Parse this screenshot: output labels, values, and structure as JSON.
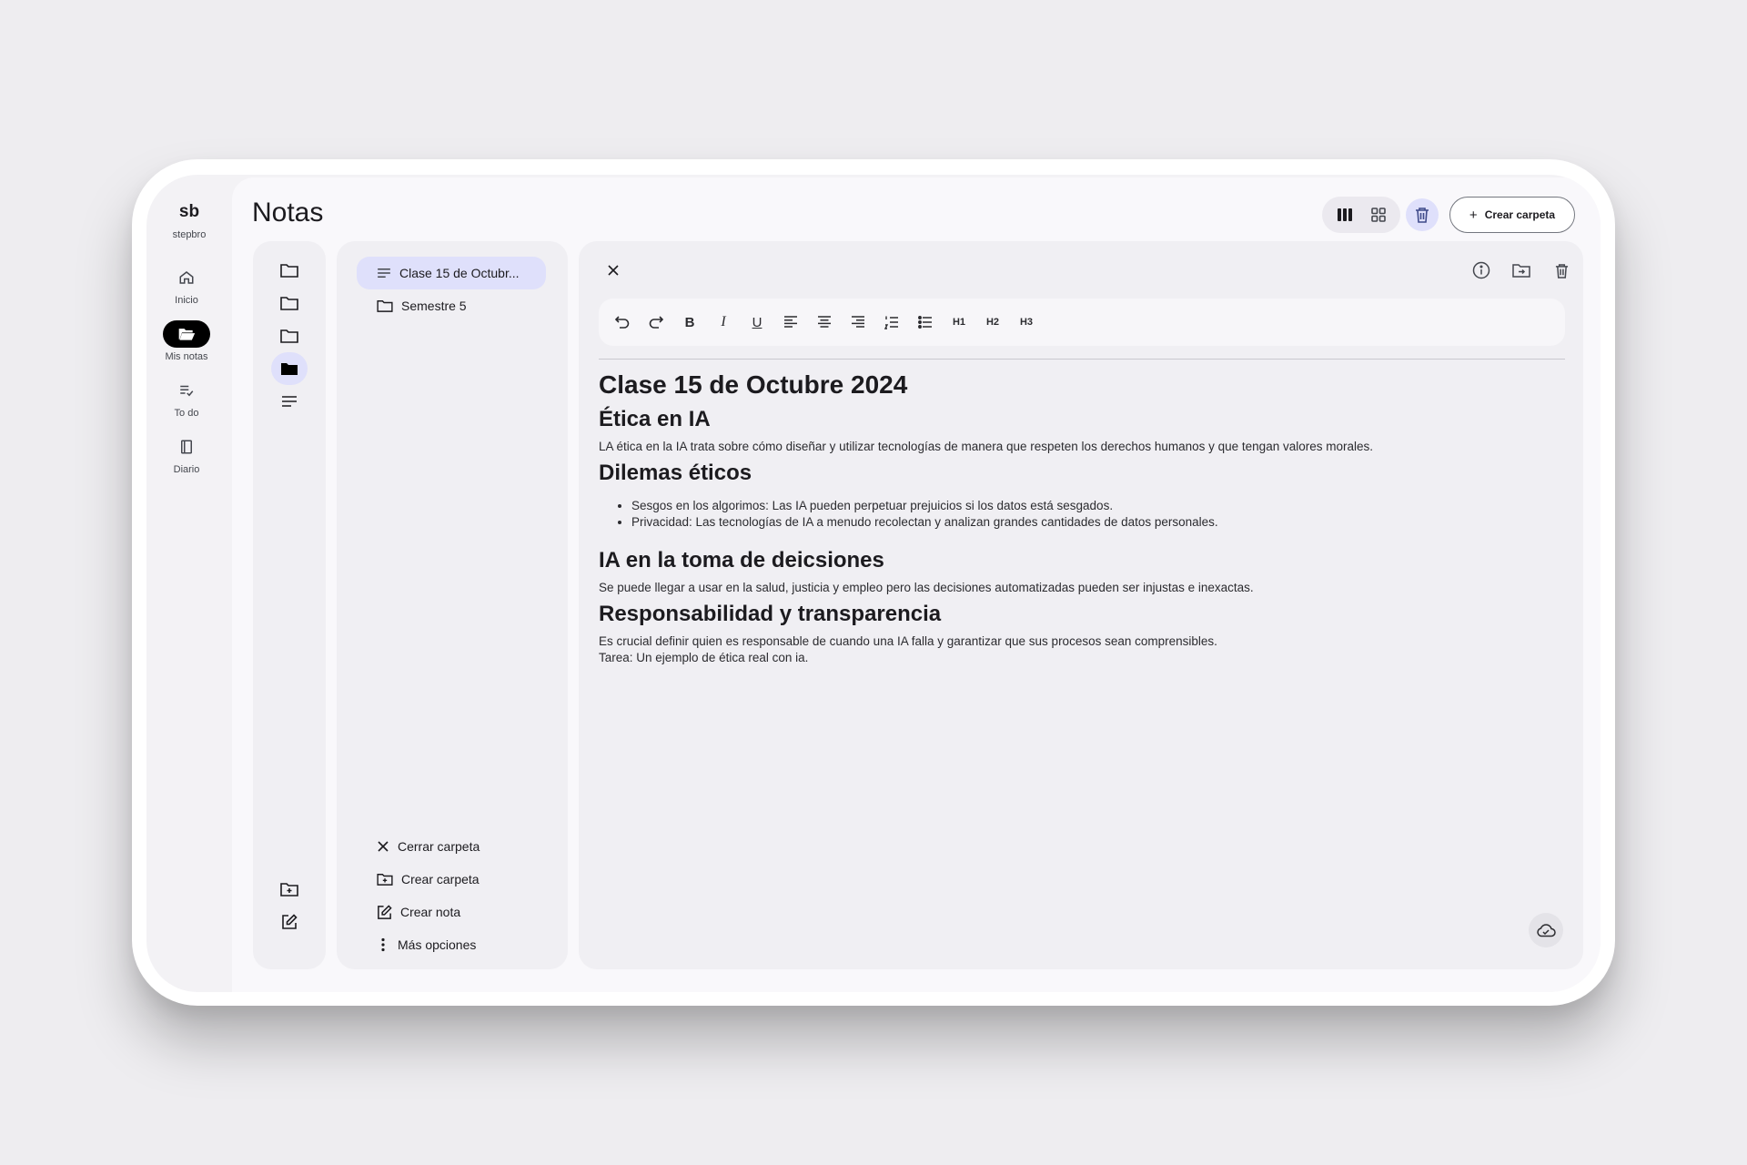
{
  "brand": {
    "logo": "sb",
    "username": "stepbro"
  },
  "nav": [
    {
      "label": "Inicio",
      "icon": "home-icon"
    },
    {
      "label": "Mis notas",
      "icon": "folder-open-icon",
      "active": true
    },
    {
      "label": "To do",
      "icon": "checklist-icon"
    },
    {
      "label": "Diario",
      "icon": "book-icon"
    }
  ],
  "header": {
    "title": "Notas",
    "create_folder_label": "Crear carpeta",
    "view_mode": "columns"
  },
  "folder_column": {
    "active_index": 3
  },
  "list": {
    "items": [
      {
        "label": "Clase 15 de Octubr...",
        "icon": "note-icon",
        "active": true
      },
      {
        "label": "Semestre 5",
        "icon": "folder-icon"
      }
    ],
    "actions": [
      {
        "label": "Cerrar carpeta",
        "icon": "close-icon"
      },
      {
        "label": "Crear carpeta",
        "icon": "folder-add-icon"
      },
      {
        "label": "Crear nota",
        "icon": "edit-note-icon"
      },
      {
        "label": "Más opciones",
        "icon": "more-vert-icon"
      }
    ]
  },
  "toolbar": {
    "h1": "H1",
    "h2": "H2",
    "h3": "H3"
  },
  "document": {
    "title": "Clase 15 de Octubre 2024",
    "s1_heading": "Ética en IA",
    "s1_text": "LA ética en la IA trata sobre cómo diseñar y utilizar tecnologías de manera que respeten los derechos humanos y que tengan valores morales.",
    "s2_heading": "Dilemas éticos",
    "s2_bullets": [
      "Sesgos en los algorimos: Las IA pueden perpetuar prejuicios si los datos está sesgados.",
      "Privacidad: Las tecnologías de IA a menudo recolectan y analizan grandes cantidades de datos personales."
    ],
    "s3_heading": "IA en la toma de deicsiones",
    "s3_text": "Se puede llegar a usar en la salud, justicia y empleo pero las decisiones automatizadas pueden ser injustas e inexactas.",
    "s4_heading": "Responsabilidad y transparencia",
    "s4_text": "Es crucial definir quien es responsable de cuando una IA falla y garantizar que sus procesos sean comprensibles.",
    "s4_text2": "Tarea: Un ejemplo de ética real con ia."
  },
  "colors": {
    "accent_container": "#dfe0fb",
    "surface": "#f0eff3",
    "background": "#eeedf0"
  }
}
